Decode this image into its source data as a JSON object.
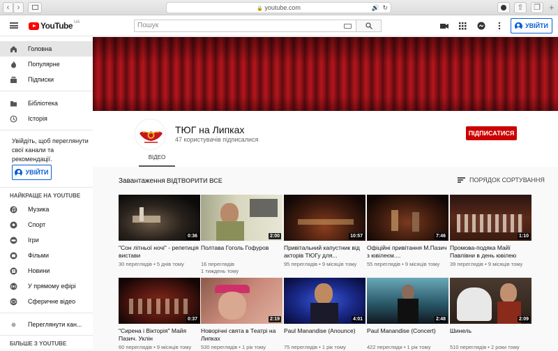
{
  "browser": {
    "url": "youtube.com"
  },
  "header": {
    "logo_text": "YouTube",
    "region": "UA",
    "search_placeholder": "Пошук",
    "signin_label": "УВІЙТИ"
  },
  "sidebar": {
    "items_top": [
      {
        "label": "Головна",
        "icon": "home-icon"
      },
      {
        "label": "Популярне",
        "icon": "fire-icon"
      },
      {
        "label": "Підписки",
        "icon": "subscriptions-icon"
      }
    ],
    "items_lib": [
      {
        "label": "Бібліотека",
        "icon": "folder-icon"
      },
      {
        "label": "Історія",
        "icon": "history-icon"
      }
    ],
    "signin_prompt": "Увійдіть, щоб переглянути свої канали та рекомендації.",
    "signin_label": "УВІЙТИ",
    "best_heading": "НАЙКРАЩЕ НА YOUTUBE",
    "best_items": [
      {
        "label": "Музика",
        "icon": "music-icon"
      },
      {
        "label": "Спорт",
        "icon": "sport-icon"
      },
      {
        "label": "Ігри",
        "icon": "games-icon"
      },
      {
        "label": "Фільми",
        "icon": "movies-icon"
      },
      {
        "label": "Новини",
        "icon": "news-icon"
      },
      {
        "label": "У прямому ефірі",
        "icon": "live-icon"
      },
      {
        "label": "Сферичне відео",
        "icon": "360-icon"
      }
    ],
    "browse_channels": "Переглянути кан...",
    "more_heading": "БІЛЬШЕ З YOUTUBE"
  },
  "channel": {
    "name": "ТЮГ на Липках",
    "subscribers": "47 користувачів підписалися",
    "subscribe_label": "ПІДПИСАТИСЯ",
    "tab_videos": "ВІДЕО",
    "shelf_title": "Завантаження",
    "play_all": "ВІДТВОРИТИ ВСЕ",
    "sort_label": "ПОРЯДОК СОРТУВАННЯ"
  },
  "videos": [
    {
      "title": "\"Сон літньої ночі\" - репетиція вистави",
      "views": "30 переглядів",
      "age": "5 днів тому",
      "duration": "0:36"
    },
    {
      "title": "Полтава Гоголь Гофуров",
      "views": "16 переглядів",
      "age": "1 тиждень тому",
      "duration": "2:00"
    },
    {
      "title": "Привітальний капустник від акторів ТЮГу для...",
      "views": "95 переглядів",
      "age": "9 місяців тому",
      "duration": "10:57"
    },
    {
      "title": "Офіційні привітання М.Пазич з ювілеєм....",
      "views": "55 переглядів",
      "age": "9 місяців тому",
      "duration": "7:46"
    },
    {
      "title": "Промова-подяка Майї Павлівни в день ювілею",
      "views": "39 переглядів",
      "age": "9 місяців тому",
      "duration": "1:10"
    },
    {
      "title": "\"Сирена і Вікторія\" Майя Пазич. Уклін",
      "views": "60 переглядів",
      "age": "9 місяців тому",
      "duration": "0:37"
    },
    {
      "title": "Новорічні свята в Театрі на Липках",
      "views": "530 переглядів",
      "age": "1 рік тому",
      "duration": "2:19"
    },
    {
      "title": "Paul Manandise (Anounce)",
      "views": "75 переглядів",
      "age": "1 рік тому",
      "duration": "4:01"
    },
    {
      "title": "Paul Manandise (Concert)",
      "views": "422 перегляди",
      "age": "1 рік тому",
      "duration": "2:48"
    },
    {
      "title": "Шинель",
      "views": "510 переглядів",
      "age": "2 роки тому",
      "duration": "2:09"
    }
  ]
}
